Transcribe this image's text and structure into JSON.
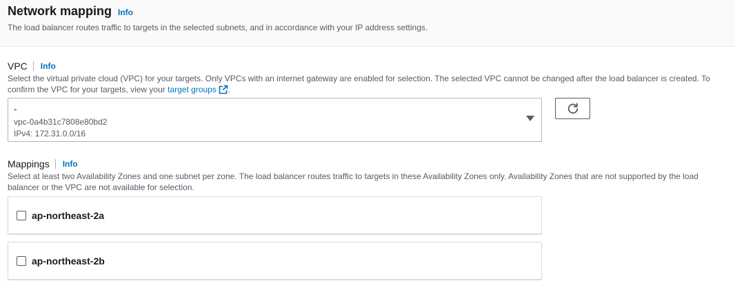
{
  "header": {
    "title": "Network mapping",
    "info": "Info",
    "description": "The load balancer routes traffic to targets in the selected subnets, and in accordance with your IP address settings."
  },
  "vpc": {
    "label": "VPC",
    "info": "Info",
    "description_part1": "Select the virtual private cloud (VPC) for your targets. Only VPCs with an internet gateway are enabled for selection. The selected VPC cannot be changed after the load balancer is created. To confirm the VPC for your targets, view your ",
    "description_link": "target groups",
    "description_end": ".",
    "select": {
      "name": "-",
      "id": "vpc-0a4b31c7808e80bd2",
      "cidr": "IPv4: 172.31.0.0/16"
    }
  },
  "mappings": {
    "label": "Mappings",
    "info": "Info",
    "description": "Select at least two Availability Zones and one subnet per zone. The load balancer routes traffic to targets in these Availability Zones only. Availability Zones that are not supported by the load balancer or the VPC are not available for selection.",
    "zones": [
      {
        "name": "ap-northeast-2a",
        "checked": false
      },
      {
        "name": "ap-northeast-2b",
        "checked": false
      }
    ]
  },
  "colors": {
    "link": "#0073bb",
    "text": "#16191f",
    "secondary_text": "#545b64",
    "header_bg": "#fafafa",
    "border": "#aab7b8"
  },
  "icons": [
    "external-link-icon",
    "refresh-icon",
    "caret-down-icon",
    "checkbox-icon"
  ]
}
